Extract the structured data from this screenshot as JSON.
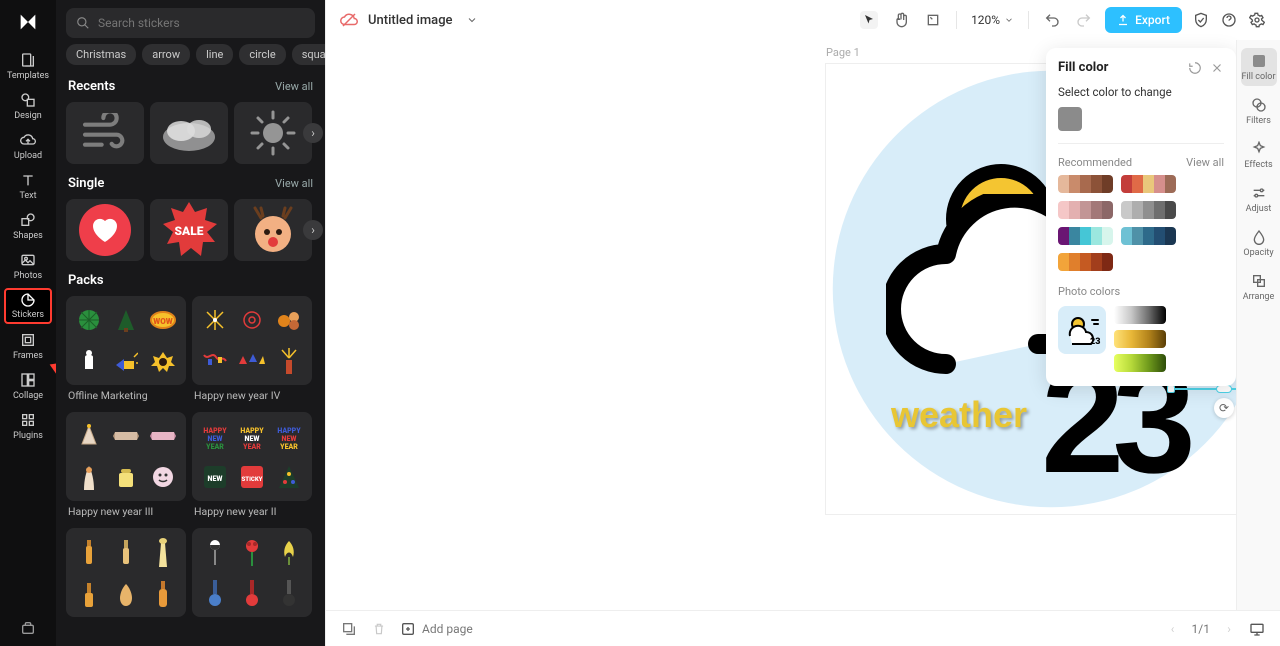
{
  "search": {
    "placeholder": "Search stickers"
  },
  "chips": [
    "Christmas",
    "arrow",
    "line",
    "circle",
    "square"
  ],
  "sections": {
    "recents": {
      "title": "Recents",
      "viewall": "View all"
    },
    "single": {
      "title": "Single",
      "viewall": "View all"
    },
    "packs": {
      "title": "Packs"
    }
  },
  "packs": [
    {
      "name": "Offline Marketing"
    },
    {
      "name": "Happy new year IV"
    },
    {
      "name": "Happy new year III"
    },
    {
      "name": "Happy new year II"
    }
  ],
  "rail": {
    "templates": "Templates",
    "design": "Design",
    "upload": "Upload",
    "text": "Text",
    "shapes": "Shapes",
    "photos": "Photos",
    "stickers": "Stickers",
    "frames": "Frames",
    "collage": "Collage",
    "plugins": "Plugins"
  },
  "topbar": {
    "title": "Untitled image",
    "zoom": "120%",
    "export": "Export"
  },
  "page": {
    "label": "Page 1"
  },
  "canvas": {
    "weather_label": "weather",
    "number": "23"
  },
  "bottombar": {
    "addpage": "Add page",
    "pager": "1/1"
  },
  "props": {
    "title": "Fill color",
    "select": "Select color to change",
    "recommended": "Recommended",
    "viewall": "View all",
    "photo": "Photo colors",
    "palettes": [
      [
        "#e5b89b",
        "#c98b6b",
        "#a86a4e",
        "#8c5238",
        "#6f3d27"
      ],
      [
        "#c33d3a",
        "#e06a47",
        "#e9c77b",
        "#d68f8c",
        "#9d6b57"
      ],
      [
        "#f5c7c7",
        "#e3b0b0",
        "#c29595",
        "#a37878",
        "#8c6767"
      ],
      [
        "#c9c9c9",
        "#aeaeae",
        "#8f8f8f",
        "#6f6f6f",
        "#4a4a4a"
      ],
      [
        "#6a1673",
        "#3a86a0",
        "#45c6d6",
        "#9be7df",
        "#d7f5ec"
      ],
      [
        "#6ec1d4",
        "#4f91a8",
        "#2e6a8a",
        "#234e72",
        "#1b3752"
      ],
      [
        "#f2a43a",
        "#e07f2c",
        "#c55a22",
        "#a23e1c",
        "#7e2914"
      ]
    ],
    "grads": [
      "linear-gradient(90deg,#ffffff,#c7c7c7,#6d6d6d,#000000)",
      "linear-gradient(90deg,#ffe27a,#e8b738,#b3831b,#5a3e06)",
      "linear-gradient(90deg,#e7ff60,#b6d93a,#6f9a1c,#2e4d09)"
    ]
  },
  "rightrail": {
    "fillcolor": "Fill color",
    "filters": "Filters",
    "effects": "Effects",
    "adjust": "Adjust",
    "opacity": "Opacity",
    "arrange": "Arrange"
  }
}
